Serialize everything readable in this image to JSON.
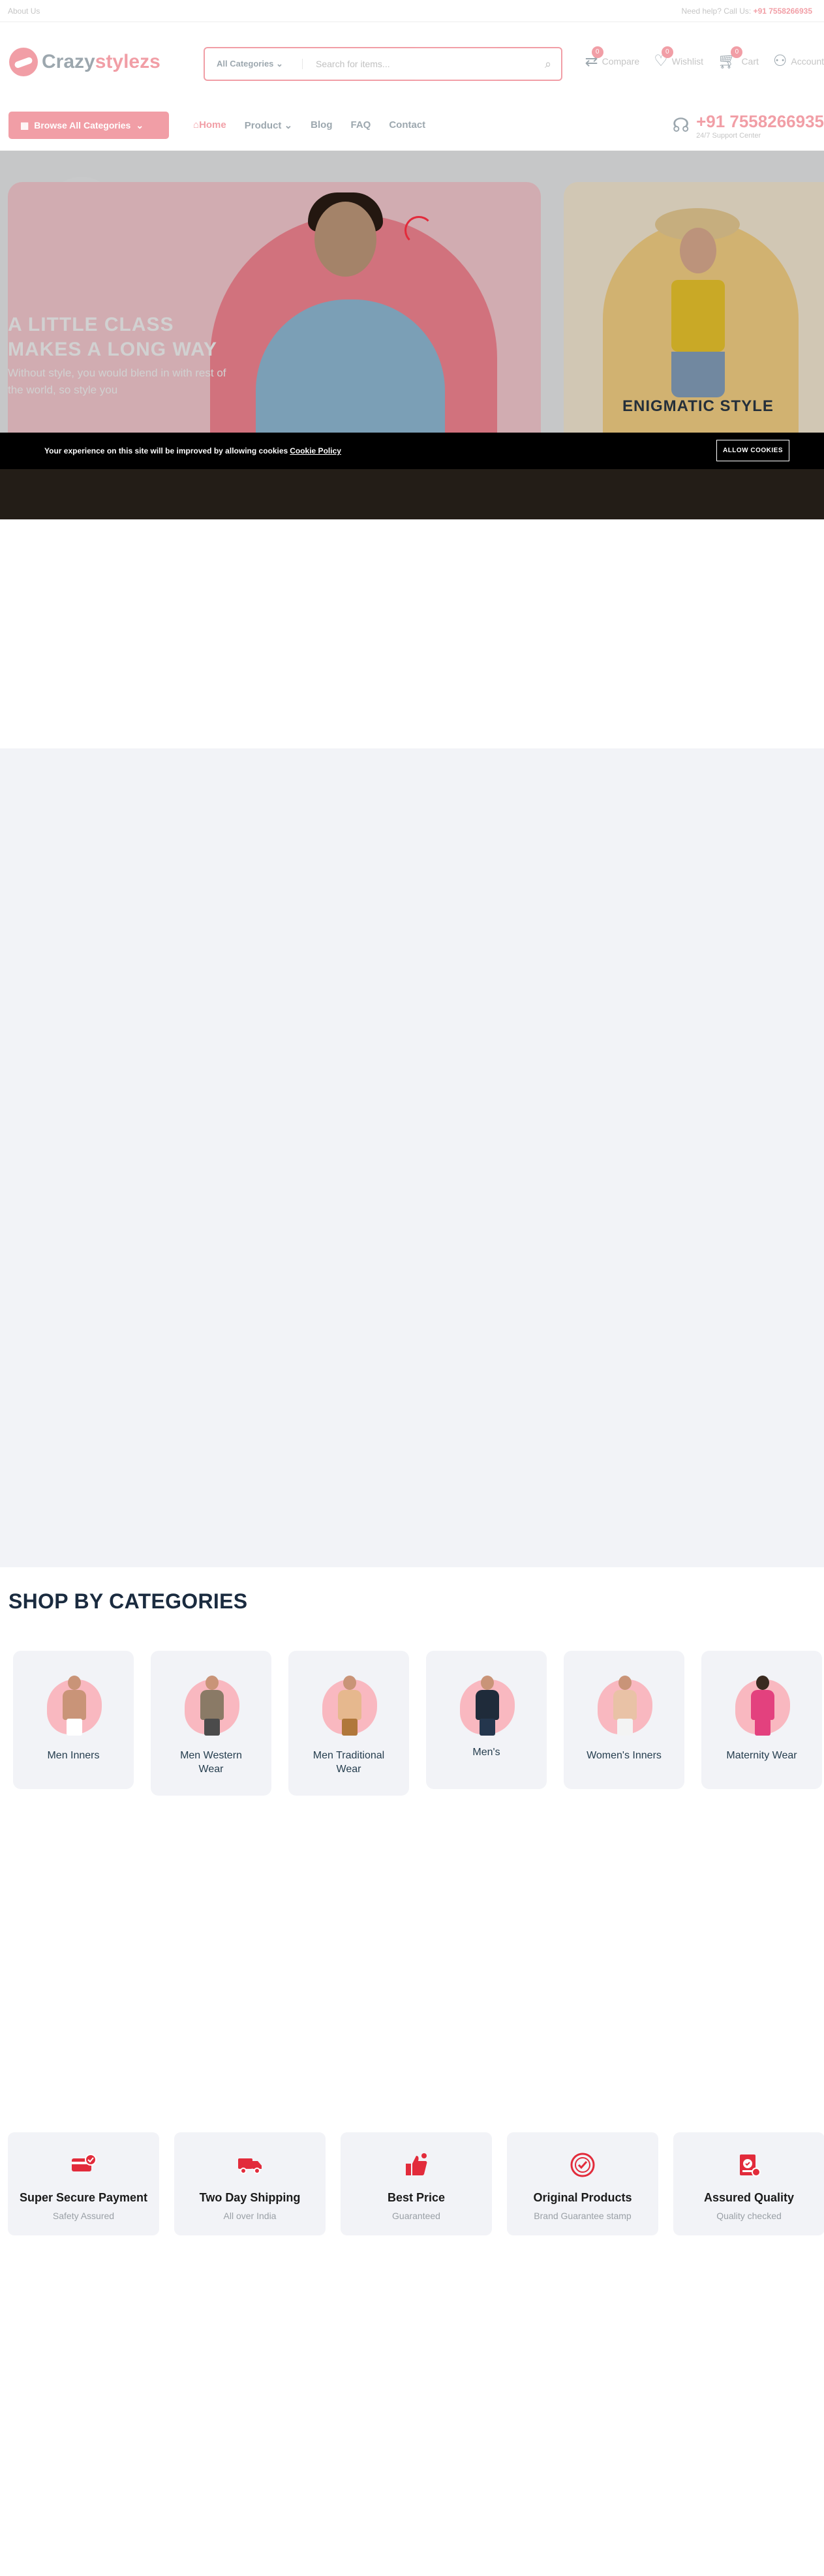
{
  "topbar": {
    "about_label": "About Us",
    "help_prefix": "Need help? Call Us:",
    "help_phone": "+91 7558266935"
  },
  "header": {
    "logo_part1": "Crazy",
    "logo_part2": "stylezs",
    "search_category": "All Categories",
    "search_placeholder": "Search for items...",
    "compare_label": "Compare",
    "compare_count": "0",
    "wishlist_label": "Wishlist",
    "wishlist_count": "0",
    "cart_label": "Cart",
    "cart_count": "0",
    "account_label": "Account"
  },
  "nav": {
    "browse_label": "Browse All Categories",
    "menu": [
      {
        "label": "Home"
      },
      {
        "label": "Product"
      },
      {
        "label": "Blog"
      },
      {
        "label": "FAQ"
      },
      {
        "label": "Contact"
      }
    ],
    "phone": "+91 7558266935",
    "phone_sub": "24/7 Support Center"
  },
  "hero": {
    "slide1_heading_line1": "A LITTLE CLASS",
    "slide1_heading_line2": "MAKES A LONG WAY",
    "slide1_text": "Without style, you would blend in with rest of the world, so style you",
    "slide2_title": "ENIGMATIC STYLE"
  },
  "cookie": {
    "message": "Your experience on this site will be improved by allowing cookies",
    "link": "Cookie Policy",
    "button": "ALLOW COOKIES"
  },
  "categories": {
    "title": "SHOP BY CATEGORIES",
    "items": [
      {
        "label": "Men Inners"
      },
      {
        "label": "Men Western Wear"
      },
      {
        "label": "Men Traditional Wear"
      },
      {
        "label": "Men's"
      },
      {
        "label": "Women's Inners"
      },
      {
        "label": "Maternity Wear"
      }
    ]
  },
  "features": [
    {
      "title": "Super Secure Payment",
      "sub": "Safety Assured",
      "icon": "secure-payment-icon"
    },
    {
      "title": "Two Day Shipping",
      "sub": "All over India",
      "icon": "truck-icon"
    },
    {
      "title": "Best Price",
      "sub": "Guaranteed",
      "icon": "best-price-icon"
    },
    {
      "title": "Original Products",
      "sub": "Brand Guarantee stamp",
      "icon": "original-stamp-icon"
    },
    {
      "title": "Assured Quality",
      "sub": "Quality checked",
      "icon": "quality-icon"
    }
  ],
  "colors": {
    "accent": "#e22b3b",
    "dark": "#253d4e",
    "card_bg": "#f2f3f7"
  }
}
